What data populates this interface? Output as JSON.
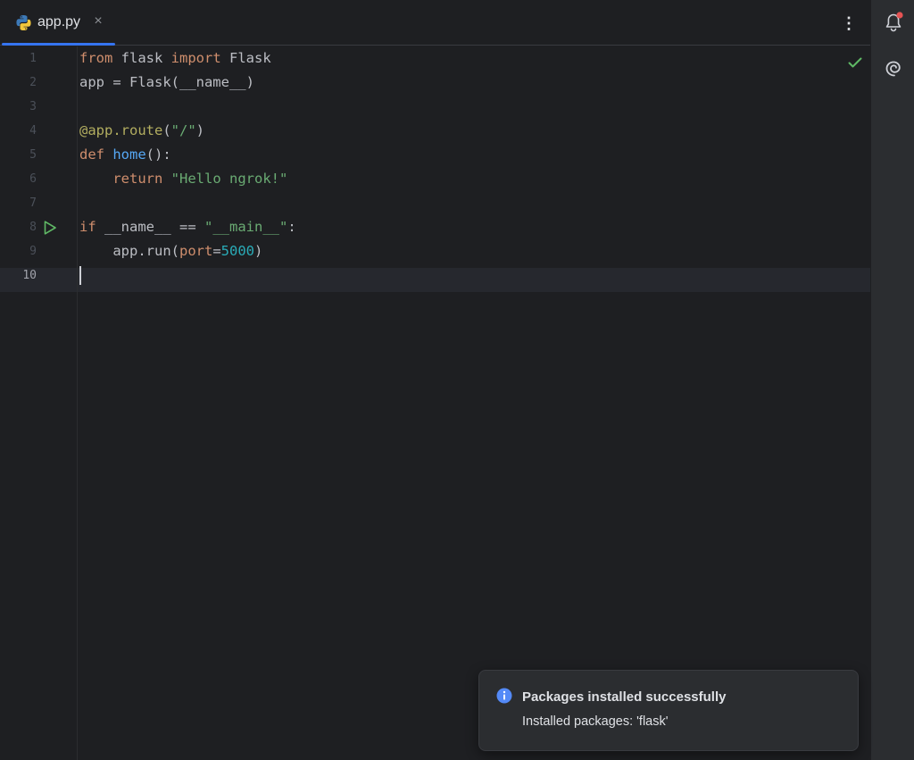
{
  "tab": {
    "title": "app.py",
    "close_glyph": "×",
    "icon": "python-icon"
  },
  "toolbar": {
    "more_glyph": "⋮"
  },
  "right_strip": {
    "icons": [
      "notifications-bell-icon",
      "ai-assistant-spiral-icon"
    ],
    "bell_badge_color": "#e55353"
  },
  "editor": {
    "current_line": 10,
    "line_numbers": [
      "1",
      "2",
      "3",
      "4",
      "5",
      "6",
      "7",
      "8",
      "9",
      "10"
    ],
    "code_lines": [
      [
        {
          "t": "from",
          "c": "kw"
        },
        {
          "t": " flask ",
          "c": ""
        },
        {
          "t": "import",
          "c": "kw"
        },
        {
          "t": " Flask",
          "c": ""
        }
      ],
      [
        {
          "t": "app = Flask(__name__)",
          "c": ""
        }
      ],
      [],
      [
        {
          "t": "@app.route",
          "c": "dec"
        },
        {
          "t": "(",
          "c": ""
        },
        {
          "t": "\"/\"",
          "c": "str"
        },
        {
          "t": ")",
          "c": ""
        }
      ],
      [
        {
          "t": "def",
          "c": "kw"
        },
        {
          "t": " ",
          "c": ""
        },
        {
          "t": "home",
          "c": "fn"
        },
        {
          "t": "():",
          "c": ""
        }
      ],
      [
        {
          "t": "    ",
          "c": ""
        },
        {
          "t": "return",
          "c": "kw"
        },
        {
          "t": " ",
          "c": ""
        },
        {
          "t": "\"Hello ngrok!\"",
          "c": "str"
        }
      ],
      [],
      [
        {
          "t": "if",
          "c": "kw"
        },
        {
          "t": " __name__ == ",
          "c": ""
        },
        {
          "t": "\"__main__\"",
          "c": "str"
        },
        {
          "t": ":",
          "c": ""
        }
      ],
      [
        {
          "t": "    app.run(",
          "c": ""
        },
        {
          "t": "port",
          "c": "param"
        },
        {
          "t": "=",
          "c": ""
        },
        {
          "t": "5000",
          "c": "num"
        },
        {
          "t": ")",
          "c": ""
        }
      ],
      []
    ]
  },
  "notification": {
    "title": "Packages installed successfully",
    "body": "Installed packages: 'flask'",
    "icon": "info-icon"
  },
  "colors": {
    "background": "#1e1f22",
    "accent": "#3574f0",
    "keyword": "#cf8e6d",
    "string": "#6aab73",
    "decorator": "#b3ae60",
    "function": "#56a8f5",
    "number": "#2aacb8",
    "run_green": "#5fb865"
  }
}
